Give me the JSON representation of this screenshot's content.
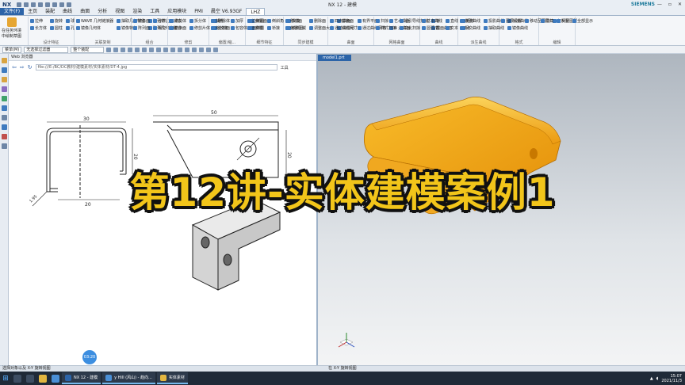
{
  "titlebar": {
    "logo": "NX",
    "title": "NX 12 - 建模",
    "brand": "SIEMENS",
    "window_controls": [
      "—",
      "▫",
      "✕"
    ]
  },
  "menubar": {
    "tabs": [
      "文件(F)",
      "主页",
      "装配",
      "曲线",
      "曲面",
      "分析",
      "视图",
      "渲染",
      "工具",
      "应用模块",
      "PMI",
      "晨空 V6.93GF",
      "LHZ"
    ],
    "active_tab": "LHZ"
  },
  "ribbon": {
    "groups": [
      {
        "label": "",
        "big": "在任务环境中绘制草图",
        "items": []
      },
      {
        "label": "设计特征",
        "items": [
          "拉伸",
          "旋转",
          "球",
          "长方体",
          "圆柱",
          "孔"
        ]
      },
      {
        "label": "关联复制",
        "items": [
          "WAVE 几何链接器",
          "抽取几何特征",
          "阵列特征",
          "镜像几何体",
          "镜像特征",
          "阵列几何特征"
        ]
      },
      {
        "label": "组合",
        "items": [
          "镜像面",
          "合并",
          "减去",
          "阵列面",
          "相交",
          "缝合"
        ]
      },
      {
        "label": "修剪",
        "items": [
          "修剪体",
          "拆分体",
          "删除体",
          "替换面",
          "修剪片体",
          "分割面"
        ]
      },
      {
        "label": "偏置/缩...",
        "items": [
          "抽壳",
          "加厚",
          "偏置面",
          "缩放体",
          "包容体",
          "拔模"
        ]
      },
      {
        "label": "细节特征",
        "items": [
          "边倒圆",
          "倒斜角",
          "拔模",
          "面倒圆",
          "桥接",
          "软倒圆"
        ]
      },
      {
        "label": "同步建模",
        "items": [
          "移动面",
          "删除面",
          "替换面",
          "偏置区域",
          "调整面大小",
          "线性尺寸"
        ]
      },
      {
        "label": "曲面",
        "items": [
          "四点曲面",
          "有界平面",
          "艺术曲面",
          "通过曲线组",
          "通过曲线网格",
          "N 边曲面"
        ]
      },
      {
        "label": "网格曲面",
        "items": [
          "扫掠",
          "沿引导线扫掠",
          "管",
          "样式扫掠",
          "变化扫掠",
          "截面曲面"
        ]
      },
      {
        "label": "曲线",
        "items": [
          "基本曲线",
          "直线",
          "矩形",
          "圆弧/圆",
          "文本",
          "点"
        ]
      },
      {
        "label": "派生曲线",
        "items": [
          "偏置曲线",
          "投影曲线",
          "桥接曲线",
          "相交曲线",
          "抽取曲线",
          "镜像曲线"
        ]
      },
      {
        "label": "格式",
        "items": [
          "图层设置",
          "移动至图层",
          "复制至图层"
        ]
      },
      {
        "label": "编辑",
        "items": [
          "隐藏",
          "反转",
          "全部显示"
        ]
      }
    ]
  },
  "toolbar": {
    "menu_label": "菜单(M)",
    "filter_value": "无选择过滤器",
    "scope_value": "整个装配"
  },
  "web_panel": {
    "header": "Web 浏览器",
    "url": "file:///E:/BC/DC教材/建模素材/实体素材/DT-4.jpg",
    "tools_label": "工具",
    "dimensions": {
      "top_width": "30",
      "right_height": "20",
      "bottom": "20",
      "thickness": "1.95",
      "flange_width": "50",
      "height2": "20"
    }
  },
  "viewport": {
    "tab_label": "model1.prt",
    "part_color": "#f2a312"
  },
  "overlay": {
    "title": "第12讲-实体建模案例1"
  },
  "video": {
    "time": "03:20"
  },
  "statusbar": {
    "left": "选择对象以及 X-Y 旋转视图",
    "right": "在 X-Y 旋转视图"
  },
  "taskbar": {
    "tasks": [
      {
        "label": "NX 12 - 建模",
        "color": "#2c64a8"
      },
      {
        "label": "y Hill (风山) - 趋向...",
        "color": "#4a8fd6"
      },
      {
        "label": "实体素材",
        "color": "#e3b640"
      }
    ],
    "tray_time": "15:07",
    "tray_date": "2021/11/3"
  },
  "colors": {
    "accent": "#2c64a8",
    "title_yellow": "#f2c51a",
    "part_orange": "#f2a312"
  }
}
